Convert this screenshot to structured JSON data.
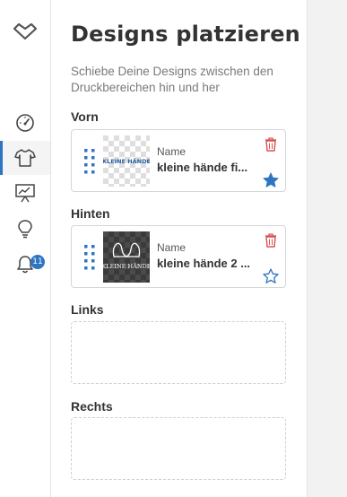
{
  "app": {
    "nav": {
      "items": [
        {
          "id": "dashboard",
          "icon": "gauge-icon"
        },
        {
          "id": "products",
          "icon": "tshirt-icon",
          "active": true
        },
        {
          "id": "presentation",
          "icon": "presentation-board-icon"
        },
        {
          "id": "ideas",
          "icon": "lightbulb-icon"
        },
        {
          "id": "notifications",
          "icon": "bell-icon",
          "badge": "11"
        }
      ]
    }
  },
  "panel": {
    "title": "Designs platzieren",
    "subtitle": "Schiebe Deine Designs zwischen den Druckbereichen hin und her",
    "sections": [
      {
        "label": "Vorn",
        "design": {
          "thumb_text": "KLEINE HÄNDE",
          "name_label": "Name",
          "name_value": "kleine hände fi...",
          "starred": true
        }
      },
      {
        "label": "Hinten",
        "design": {
          "thumb_text": "KLEINE HÄNDE",
          "name_label": "Name",
          "name_value": "kleine hände 2 ...",
          "starred": false
        }
      },
      {
        "label": "Links",
        "design": null
      },
      {
        "label": "Rechts",
        "design": null
      }
    ]
  },
  "colors": {
    "accent": "#2f76c2",
    "trash": "#d9534f",
    "text": "#333333",
    "muted": "#7a7a7a"
  }
}
